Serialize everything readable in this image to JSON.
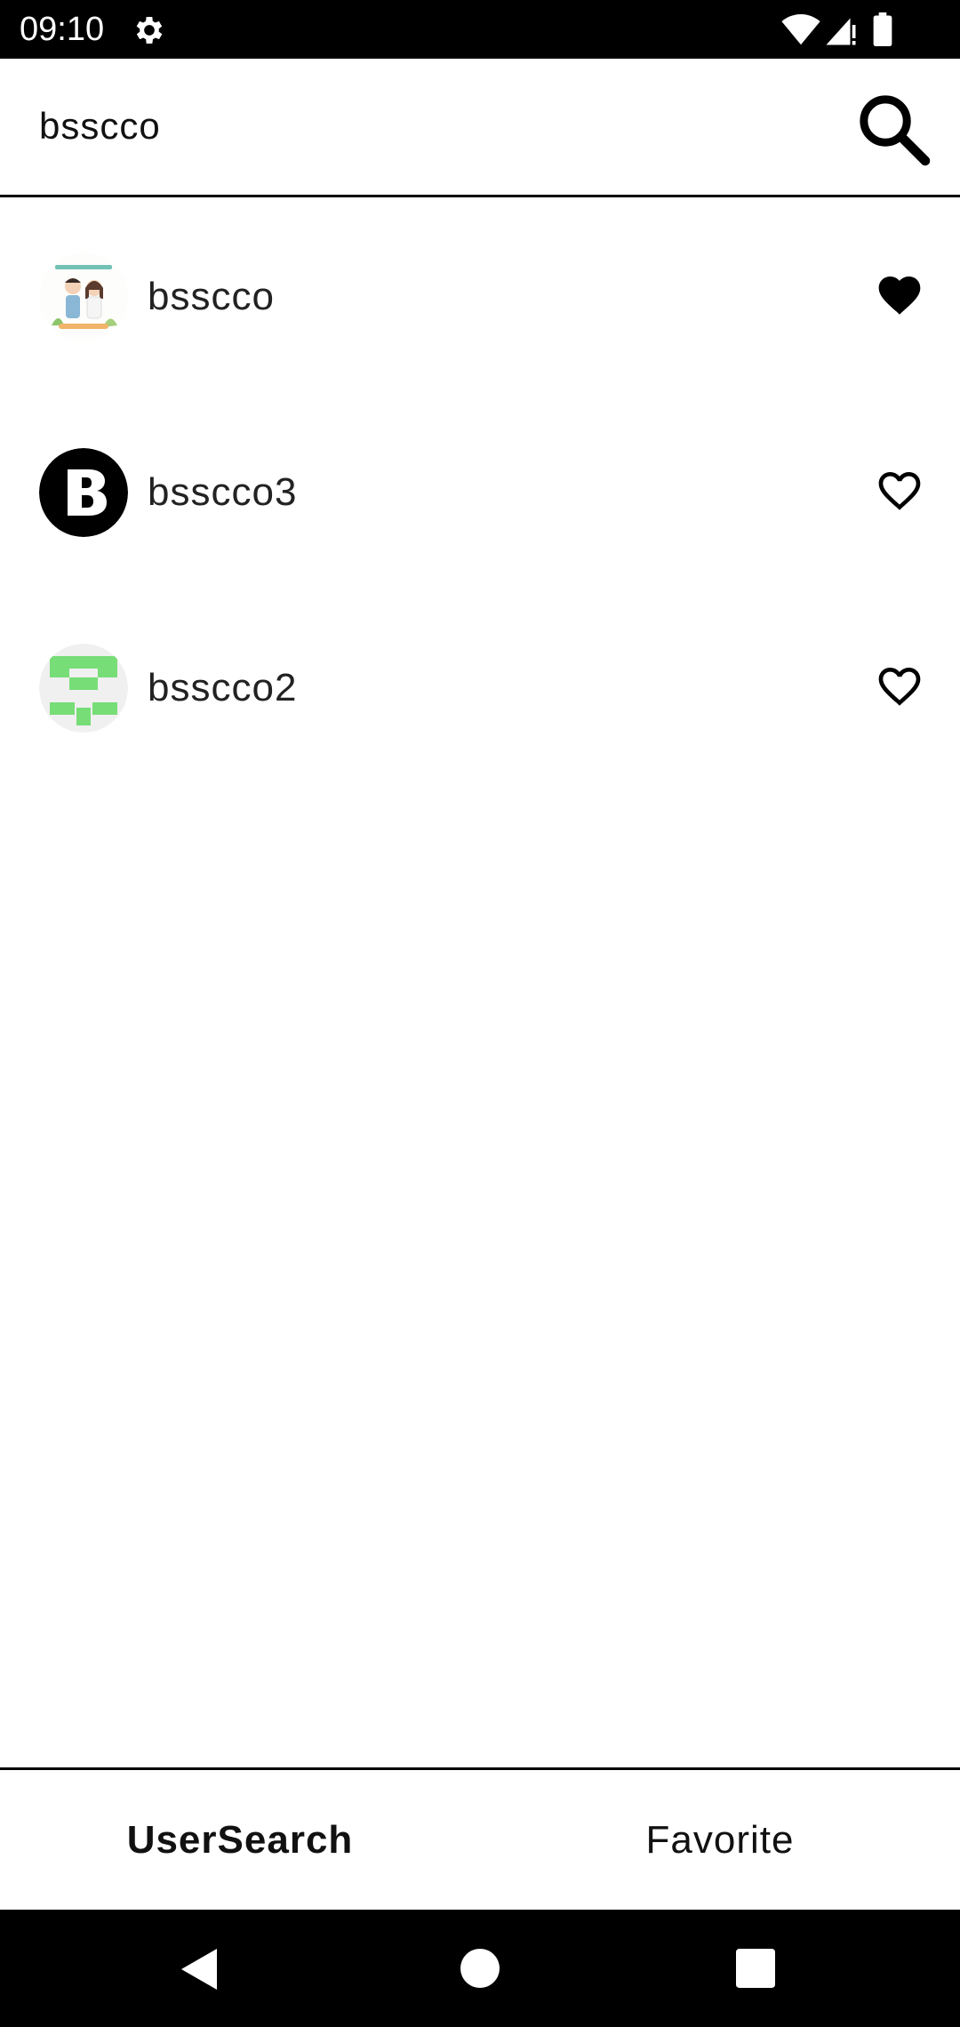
{
  "status_bar": {
    "time": "09:10",
    "icons": [
      "gear-icon",
      "wifi-icon",
      "signal-icon",
      "battery-icon"
    ]
  },
  "search": {
    "value": "bsscco",
    "icon": "search-icon"
  },
  "users": [
    {
      "name": "bsscco",
      "favorited": true,
      "avatar": "couple-illustration-avatar"
    },
    {
      "name": "bsscco3",
      "favorited": false,
      "avatar": "letter-b-avatar"
    },
    {
      "name": "bsscco2",
      "favorited": false,
      "avatar": "green-pattern-avatar"
    }
  ],
  "tabs": [
    {
      "label": "UserSearch",
      "selected": true
    },
    {
      "label": "Favorite",
      "selected": false
    }
  ],
  "nav": [
    "back-icon",
    "home-icon",
    "recents-icon"
  ],
  "colors": {
    "background": "#ffffff",
    "text": "#111111",
    "bars": "#000000",
    "avatar_green": "#77dd77"
  }
}
